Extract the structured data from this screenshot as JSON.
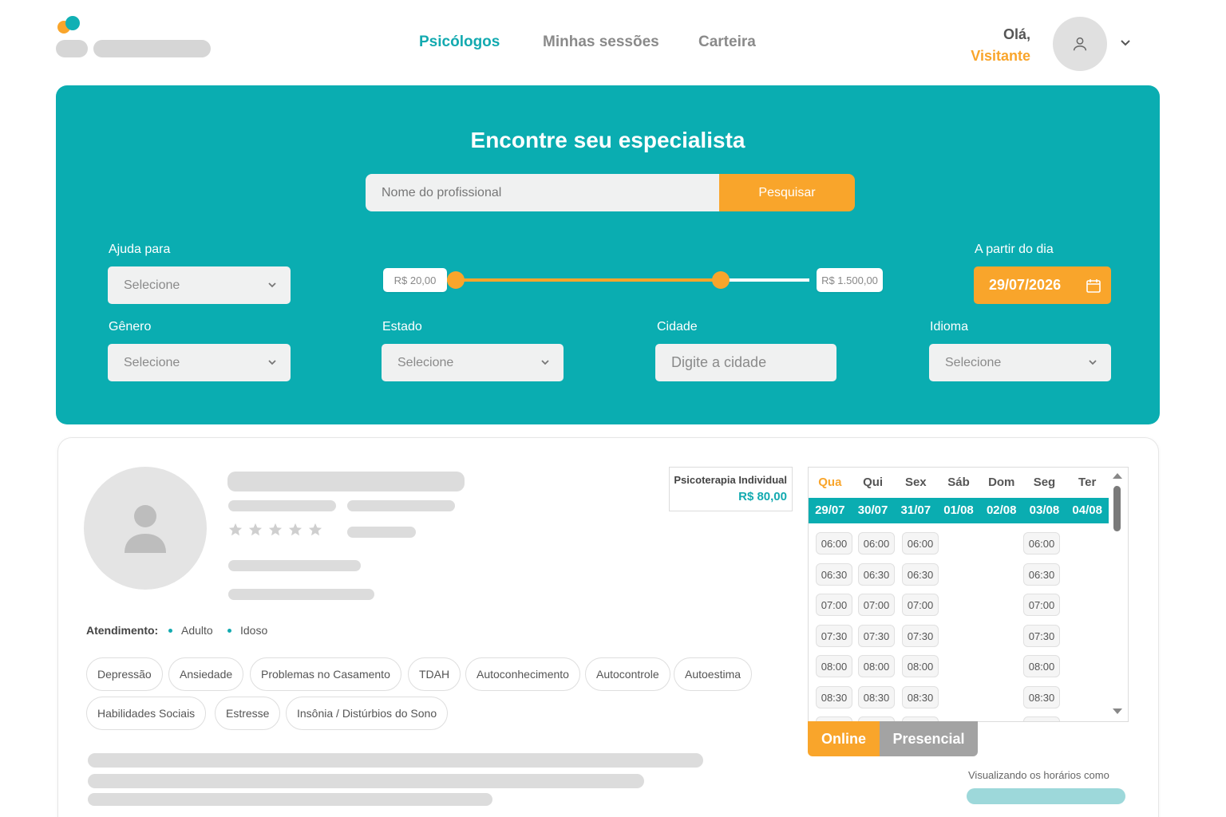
{
  "header": {
    "nav": [
      {
        "label": "Psicólogos"
      },
      {
        "label": "Minhas sessões"
      },
      {
        "label": "Carteira"
      }
    ],
    "greeting": "Olá,",
    "user_name": "Visitante"
  },
  "search": {
    "title": "Encontre seu especialista",
    "placeholder": "Nome do profissional",
    "button": "Pesquisar"
  },
  "filters": {
    "help_label": "Ajuda para",
    "help_value": "Selecione",
    "price_min": "R$ 20,00",
    "price_max": "R$ 1.500,00",
    "price_range_fraction": [
      0.0,
      0.76
    ],
    "date_label": "A partir do dia",
    "date_value": "29/07/2026",
    "gender_label": "Gênero",
    "gender_value": "Selecione",
    "state_label": "Estado",
    "state_value": "Selecione",
    "city_label": "Cidade",
    "city_placeholder": "Digite a cidade",
    "language_label": "Idioma",
    "language_value": "Selecione"
  },
  "profile": {
    "rating_stars": 0,
    "attendance_label": "Atendimento:",
    "attendance": [
      "Adulto",
      "Idoso"
    ],
    "tags": [
      "Depressão",
      "Ansiedade",
      "Problemas no Casamento",
      "TDAH",
      "Autoconhecimento",
      "Autocontrole",
      "Autoestima",
      "Habilidades Sociais",
      "Estresse",
      "Insônia / Distúrbios do Sono"
    ],
    "service": "Psicoterapia Individual",
    "price": "R$ 80,00"
  },
  "schedule": {
    "days": [
      "Qua",
      "Qui",
      "Sex",
      "Sáb",
      "Dom",
      "Seg",
      "Ter"
    ],
    "dates": [
      "29/07",
      "30/07",
      "31/07",
      "01/08",
      "02/08",
      "03/08",
      "04/08"
    ],
    "times": [
      "06:00",
      "06:30",
      "07:00",
      "07:30",
      "08:00",
      "08:30"
    ],
    "mode_online": "Online",
    "mode_presencial": "Presencial",
    "viewing_text": "Visualizando os horários como"
  },
  "colors": {
    "teal": "#0aadb1",
    "orange": "#f9a52b"
  }
}
